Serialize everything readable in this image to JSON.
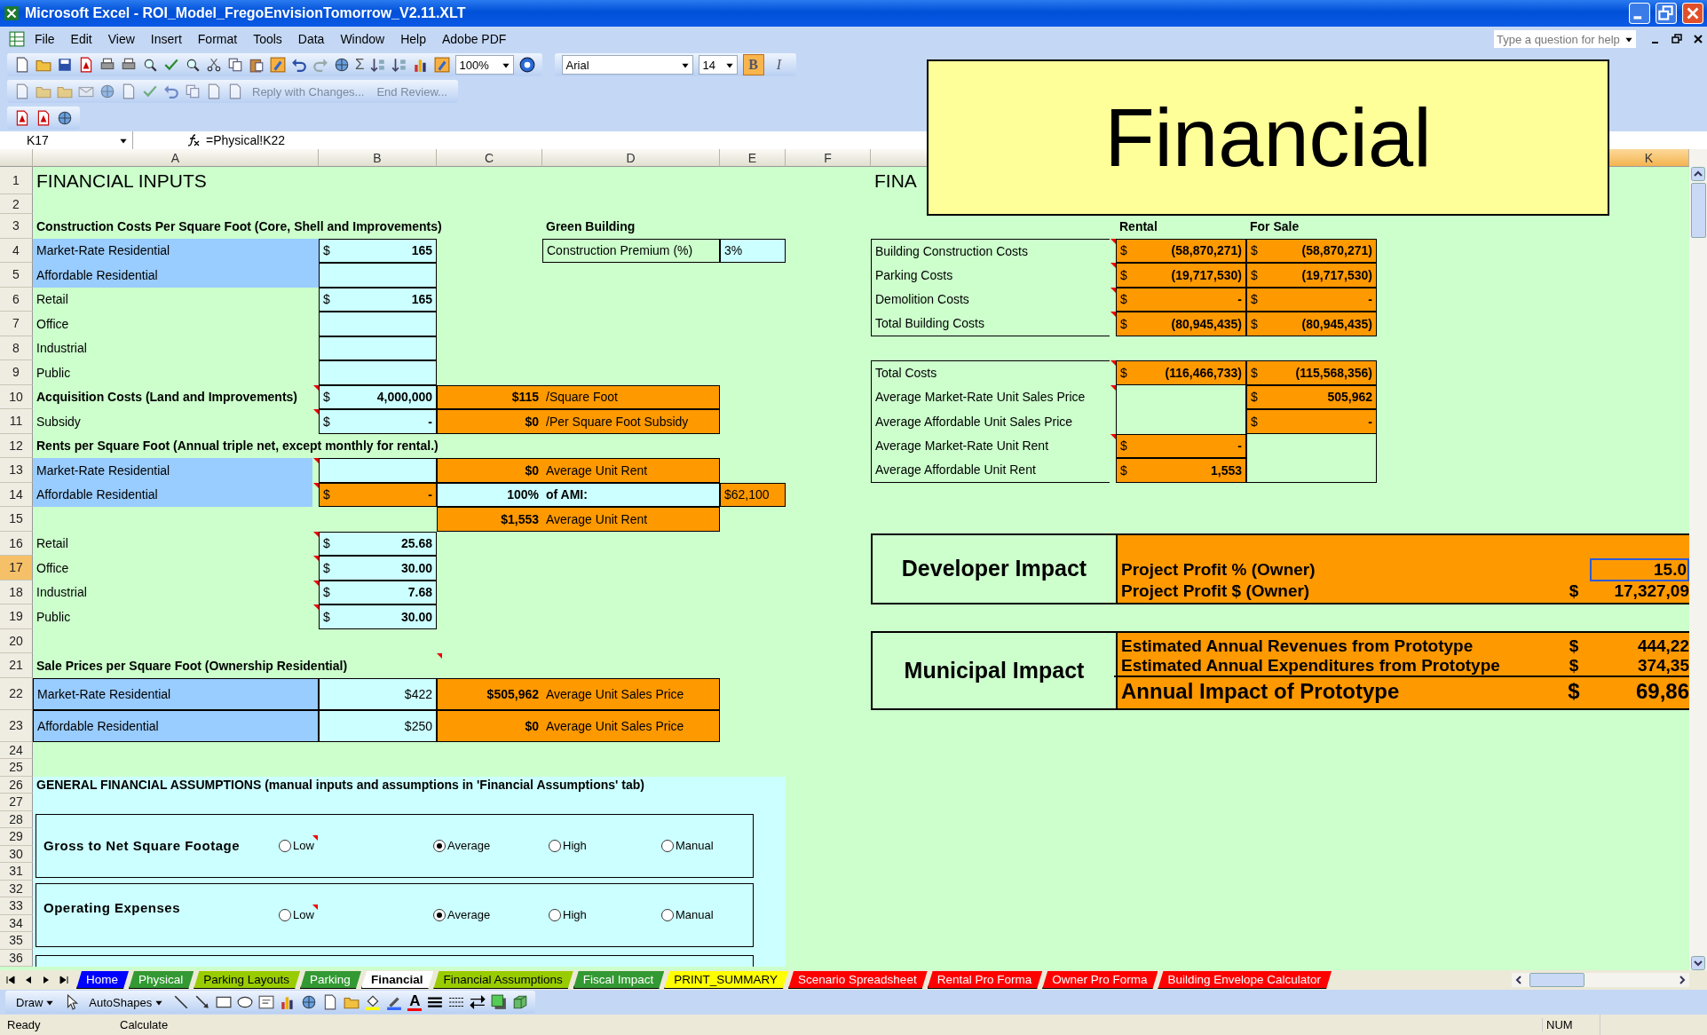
{
  "window": {
    "title": "Microsoft Excel - ROI_Model_FregoEnvisionTomorrow_V2.11.XLT"
  },
  "menu": [
    "File",
    "Edit",
    "View",
    "Insert",
    "Format",
    "Tools",
    "Data",
    "Window",
    "Help",
    "Adobe PDF"
  ],
  "help_search": {
    "placeholder": "Type a question for help"
  },
  "toolbar": {
    "sum": "Σ",
    "zoom": "100%",
    "font": "Arial",
    "size": "14",
    "format_buttons": [
      {
        "label": "B",
        "on": true
      },
      {
        "label": "I",
        "on": false
      }
    ]
  },
  "review_toolbar": {
    "reply": "Reply with Changes...",
    "end": "End Review..."
  },
  "formula_bar": {
    "name_box": "K17",
    "formula": "=Physical!K22"
  },
  "columns": [
    {
      "label": "A",
      "selected": false
    },
    {
      "label": "B",
      "selected": false
    },
    {
      "label": "C",
      "selected": false
    },
    {
      "label": "D",
      "selected": false
    },
    {
      "label": "E",
      "selected": false
    },
    {
      "label": "F",
      "selected": false
    },
    {
      "label": "K",
      "selected": true
    }
  ],
  "row_numbers": [
    {
      "label": "1",
      "selected": false
    },
    {
      "label": "2",
      "selected": false
    },
    {
      "label": "3",
      "selected": false
    },
    {
      "label": "4",
      "selected": false
    },
    {
      "label": "5",
      "selected": false
    },
    {
      "label": "6",
      "selected": false
    },
    {
      "label": "7",
      "selected": false
    },
    {
      "label": "8",
      "selected": false
    },
    {
      "label": "9",
      "selected": false
    },
    {
      "label": "10",
      "selected": false
    },
    {
      "label": "11",
      "selected": false
    },
    {
      "label": "12",
      "selected": false
    },
    {
      "label": "13",
      "selected": false
    },
    {
      "label": "14",
      "selected": false
    },
    {
      "label": "15",
      "selected": false
    },
    {
      "label": "16",
      "selected": false
    },
    {
      "label": "17",
      "selected": true
    },
    {
      "label": "18",
      "selected": false
    },
    {
      "label": "19",
      "selected": false
    },
    {
      "label": "20",
      "selected": false
    },
    {
      "label": "21",
      "selected": false
    },
    {
      "label": "22",
      "selected": false
    },
    {
      "label": "23",
      "selected": false
    },
    {
      "label": "24",
      "selected": false
    },
    {
      "label": "25",
      "selected": false
    },
    {
      "label": "26",
      "selected": false
    },
    {
      "label": "27",
      "selected": false
    },
    {
      "label": "28",
      "selected": false
    },
    {
      "label": "29",
      "selected": false
    },
    {
      "label": "30",
      "selected": false
    },
    {
      "label": "31",
      "selected": false
    },
    {
      "label": "32",
      "selected": false
    },
    {
      "label": "33",
      "selected": false
    },
    {
      "label": "34",
      "selected": false
    },
    {
      "label": "35",
      "selected": false
    },
    {
      "label": "36",
      "selected": false
    }
  ],
  "overlay_title": "Financial",
  "inputs": {
    "title": "FINANCIAL INPUTS",
    "construction": {
      "heading": "Construction Costs Per Square Foot (Core, Shell and Improvements)",
      "rows": [
        {
          "label": "Market-Rate Residential",
          "highlight": true,
          "currency": "$",
          "value": "165"
        },
        {
          "label": "Affordable Residential",
          "highlight": true
        },
        {
          "label": "Retail",
          "highlight": false,
          "currency": "$",
          "value": "165"
        },
        {
          "label": "Office",
          "highlight": false
        },
        {
          "label": "Industrial",
          "highlight": false
        },
        {
          "label": "Public",
          "highlight": false
        }
      ]
    },
    "green_building": {
      "heading": "Green Building",
      "label": "Construction Premium (%)",
      "value": "3%"
    },
    "acquisition": [
      {
        "label": "Acquisition Costs (Land and Improvements)",
        "bold": true,
        "note": true,
        "currency": "$",
        "value": "4,000,000",
        "result": "$115",
        "unit": "/Square Foot"
      },
      {
        "label": "Subsidy",
        "bold": false,
        "note": true,
        "currency": "$",
        "value": "-",
        "result": "$0",
        "unit": "/Per Square Foot Subsidy"
      }
    ],
    "rents": {
      "heading": "Rents per Square Foot (Annual triple net, except monthly for rental.)",
      "market": {
        "label": "Market-Rate Residential",
        "highlight": true,
        "note": true,
        "result": "$0",
        "unit": "Average Unit Rent"
      },
      "affordable": {
        "label": "Affordable Residential",
        "highlight": true,
        "note": true,
        "currency": "$",
        "value": "-",
        "percent": "100%",
        "ami_label": "of AMI:",
        "ami": "$62,100",
        "result": "$1,553",
        "unit": "Average Unit Rent"
      },
      "rows": [
        {
          "label": "Retail",
          "note": true,
          "currency": "$",
          "value": "25.68"
        },
        {
          "label": "Office",
          "note": true,
          "currency": "$",
          "value": "30.00"
        },
        {
          "label": "Industrial",
          "note": true,
          "currency": "$",
          "value": "7.68"
        },
        {
          "label": "Public",
          "note": true,
          "currency": "$",
          "value": "30.00"
        }
      ]
    },
    "sale": {
      "heading": "Sale Prices per Square Foot (Ownership Residential)",
      "note": true,
      "rows": [
        {
          "label": "Market-Rate Residential",
          "highlight": true,
          "value": "$422",
          "result": "$505,962",
          "unit": "Average Unit Sales Price"
        },
        {
          "label": "Affordable Residential",
          "highlight": true,
          "value": "$250",
          "result": "$0",
          "unit": "Average Unit Sales Price"
        }
      ]
    },
    "assumptions": {
      "heading": "GENERAL FINANCIAL ASSUMPTIONS (manual inputs and assumptions in 'Financial Assumptions' tab)",
      "groups": [
        {
          "label": "Gross to Net Square Footage",
          "options": [
            {
              "label": "Low",
              "selected": false,
              "note": true
            },
            {
              "label": "Average",
              "selected": true,
              "note": false
            },
            {
              "label": "High",
              "selected": false,
              "note": false
            },
            {
              "label": "Manual",
              "selected": false,
              "note": false
            }
          ]
        },
        {
          "label": "Operating Expenses",
          "options": [
            {
              "label": "Low",
              "selected": false,
              "note": true
            },
            {
              "label": "Average",
              "selected": true,
              "note": false
            },
            {
              "label": "High",
              "selected": false,
              "note": false
            },
            {
              "label": "Manual",
              "selected": false,
              "note": false
            }
          ]
        }
      ]
    }
  },
  "summary": {
    "heading": "FINA",
    "columns": [
      "Rental",
      "For Sale"
    ],
    "costs": [
      {
        "label": "Building Construction Costs",
        "note": true,
        "rental": {
          "currency": "$",
          "value": "(58,870,271)"
        },
        "sale": {
          "currency": "$",
          "value": "(58,870,271)"
        }
      },
      {
        "label": "Parking Costs",
        "note": true,
        "rental": {
          "currency": "$",
          "value": "(19,717,530)"
        },
        "sale": {
          "currency": "$",
          "value": "(19,717,530)"
        }
      },
      {
        "label": "Demolition Costs",
        "note": true,
        "rental": {
          "currency": "$",
          "value": "-"
        },
        "sale": {
          "currency": "$",
          "value": "-"
        }
      },
      {
        "label": "Total Building Costs",
        "note": true,
        "rental": {
          "currency": "$",
          "value": "(80,945,435)"
        },
        "sale": {
          "currency": "$",
          "value": "(80,945,435)"
        }
      }
    ],
    "prices": [
      {
        "label": "Total Costs",
        "note": true,
        "rental": {
          "currency": "$",
          "value": "(116,466,733)"
        },
        "sale": {
          "currency": "$",
          "value": "(115,568,356)"
        }
      },
      {
        "label": "Average Market-Rate Unit Sales Price",
        "note": true,
        "sale": {
          "currency": "$",
          "value": "505,962"
        }
      },
      {
        "label": "Average Affordable Unit Sales Price",
        "sale": {
          "currency": "$",
          "value": "-"
        }
      },
      {
        "label": "Average Market-Rate Unit Rent",
        "note": true,
        "rental": {
          "currency": "$",
          "value": "-"
        }
      },
      {
        "label": "Average Affordable Unit Rent",
        "rental": {
          "currency": "$",
          "value": "1,553"
        }
      }
    ],
    "developer": {
      "title": "Developer Impact",
      "rows": [
        {
          "label": "Project Profit % (Owner)",
          "value": "15.0",
          "selected": true
        },
        {
          "label": "Project Profit $ (Owner)",
          "currency": "$",
          "value": "17,327,09",
          "selected": false
        }
      ]
    },
    "municipal": {
      "title": "Municipal Impact",
      "rows": [
        {
          "label": "Estimated Annual Revenues from Prototype",
          "kind": "line",
          "currency": "$",
          "value": "444,22"
        },
        {
          "label": "Estimated Annual Expenditures from Prototype",
          "kind": "line",
          "currency": "$",
          "value": "374,35"
        },
        {
          "label": "Annual Impact of Prototype",
          "kind": "total",
          "currency": "$",
          "value": "69,86"
        }
      ]
    }
  },
  "sheet_tabs": [
    {
      "label": "Home",
      "color": "#0000ff",
      "selected": false
    },
    {
      "label": "Physical",
      "color": "#339933",
      "selected": false
    },
    {
      "label": "Parking Layouts",
      "color": "#99cc00",
      "selected": false
    },
    {
      "label": "Parking",
      "color": "#339933",
      "selected": false
    },
    {
      "label": "Financial",
      "color": "#ffffff",
      "selected": true
    },
    {
      "label": "Financial Assumptions",
      "color": "#99cc00",
      "selected": false
    },
    {
      "label": "Fiscal Impact",
      "color": "#339933",
      "selected": false
    },
    {
      "label": "PRINT_SUMMARY",
      "color": "#ffff00",
      "selected": false
    },
    {
      "label": "Scenario Spreadsheet",
      "color": "#ff0000",
      "selected": false
    },
    {
      "label": "Rental Pro Forma",
      "color": "#ff0000",
      "selected": false
    },
    {
      "label": "Owner Pro Forma",
      "color": "#ff0000",
      "selected": false
    },
    {
      "label": "Building Envelope Calculator",
      "color": "#ff0000",
      "selected": false
    }
  ],
  "drawing_toolbar": {
    "draw": "Draw",
    "autoshapes": "AutoShapes",
    "font_color": "A"
  },
  "status_bar": {
    "state": "Ready",
    "mode": "Calculate",
    "num": "NUM"
  }
}
